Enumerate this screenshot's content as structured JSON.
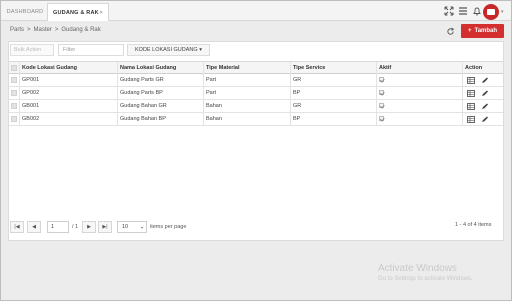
{
  "tabs": [
    {
      "label": "DASHBOARD"
    },
    {
      "label": "GUDANG & RAK",
      "close": "×"
    }
  ],
  "breadcrumb": [
    "Parts",
    ">",
    "Master",
    ">",
    "Gudang & Rak"
  ],
  "header": {
    "add_label": "Tambah",
    "add_icon": "+"
  },
  "toolbar": {
    "bulk_action": "Bulk Action",
    "filter_placeholder": "Filter",
    "sort_field": "KODE LOKASI GUDANG"
  },
  "table": {
    "columns": [
      "Kode Lokasi Gudang",
      "Nama Lokasi Gudang",
      "Tipe Material",
      "Tipe Service",
      "Aktif",
      "Action"
    ],
    "rows": [
      {
        "kode": "GP001",
        "nama": "Gudang Parts GR",
        "material": "Part",
        "service": "GR",
        "aktif": true
      },
      {
        "kode": "GP002",
        "nama": "Gudang Parts BP",
        "material": "Part",
        "service": "BP",
        "aktif": true
      },
      {
        "kode": "GB001",
        "nama": "Gudang Bahan GR",
        "material": "Bahan",
        "service": "GR",
        "aktif": true
      },
      {
        "kode": "GB002",
        "nama": "Gudang Bahan BP",
        "material": "Bahan",
        "service": "BP",
        "aktif": true
      }
    ]
  },
  "pager": {
    "first": "|◀",
    "prev": "◀",
    "page": "1",
    "of_pages": "/ 1",
    "next": "▶",
    "last": "▶|",
    "page_size": "10",
    "page_size_label": "items per page",
    "count": "1 - 4 of 4 items"
  },
  "watermark": {
    "line1": "Activate Windows",
    "line2": "Go to Settings to activate Windows."
  },
  "colors": {
    "accent": "#d32f2f",
    "avatar": "#c62828"
  }
}
